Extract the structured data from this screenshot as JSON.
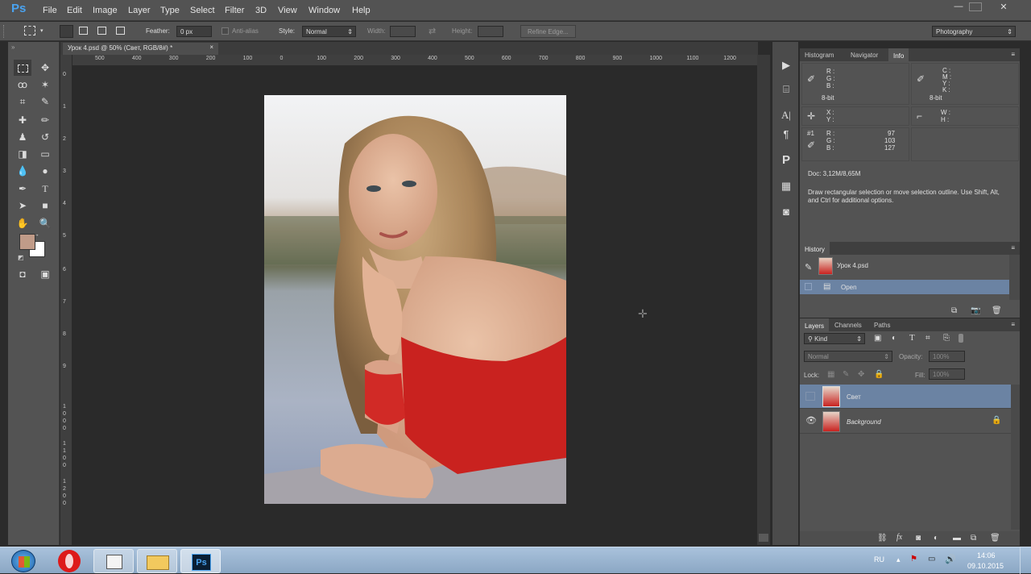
{
  "app": {
    "logo": "Ps"
  },
  "menu": [
    "File",
    "Edit",
    "Image",
    "Layer",
    "Type",
    "Select",
    "Filter",
    "3D",
    "View",
    "Window",
    "Help"
  ],
  "window_controls": {
    "minimize": "—",
    "restore": "▫",
    "close": "✕"
  },
  "options": {
    "feather_label": "Feather:",
    "feather_value": "0 px",
    "antialias_label": "Anti-alias",
    "style_label": "Style:",
    "style_value": "Normal",
    "width_label": "Width:",
    "height_label": "Height:",
    "refine_edge": "Refine Edge...",
    "workspace": "Photography"
  },
  "document": {
    "tab_title": "Урок 4.psd @ 50% (Свет, RGB/8#) *",
    "close": "×"
  },
  "ruler": {
    "h": [
      "500",
      "400",
      "300",
      "200",
      "100",
      "0",
      "100",
      "200",
      "300",
      "400",
      "500",
      "600",
      "700",
      "800",
      "900",
      "1000",
      "1100",
      "1200",
      "1300"
    ],
    "v": [
      "0",
      "1",
      "2",
      "3",
      "4",
      "5",
      "6",
      "7",
      "8",
      "9",
      "1\n0\n0\n0",
      "1\n1\n0\n0",
      "1\n2\n0\n0"
    ]
  },
  "info_panel": {
    "tabs": [
      "Histogram",
      "Navigator",
      "Info"
    ],
    "rgb": [
      "R :",
      "G :",
      "B :"
    ],
    "cmyk": [
      "C :",
      "M :",
      "Y :",
      "K :"
    ],
    "bit_left": "8-bit",
    "bit_right": "8-bit",
    "xy": [
      "X :",
      "Y :"
    ],
    "wh": [
      "W :",
      "H :"
    ],
    "sample_label": "#1",
    "sample_channels": [
      "R :",
      "G :",
      "B :"
    ],
    "sample_values": [
      "97",
      "103",
      "127"
    ],
    "doc": "Doc: 3,12M/8,65M",
    "hint": "Draw rectangular selection or move selection outline.  Use Shift, Alt, and Ctrl for additional options."
  },
  "history_panel": {
    "title": "History",
    "snapshot": "Урок 4.psd",
    "states": [
      "Open"
    ]
  },
  "layers_panel": {
    "tabs": [
      "Layers",
      "Channels",
      "Paths"
    ],
    "filter": "Kind",
    "blend": "Normal",
    "opacity_label": "Opacity:",
    "opacity_value": "100%",
    "lock_label": "Lock:",
    "fill_label": "Fill:",
    "fill_value": "100%",
    "layers": [
      {
        "name": "Свет",
        "visible": false,
        "selected": true
      },
      {
        "name": "Background",
        "visible": true,
        "selected": false,
        "locked": true
      }
    ]
  },
  "taskbar": {
    "lang": "RU",
    "time": "14:06",
    "date": "09.10.2015",
    "ps_label": "Ps"
  },
  "colors": {
    "foreground": "#c09b88",
    "background": "#ffffff",
    "selection": "#6b83a3",
    "ps_blue": "#4aa3f0"
  }
}
